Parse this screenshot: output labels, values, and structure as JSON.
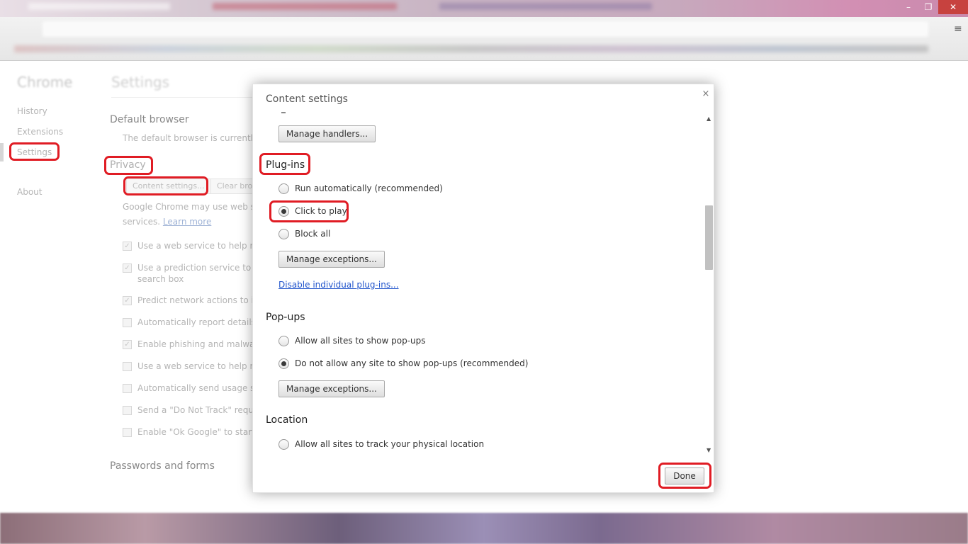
{
  "window": {
    "minimize_icon": "minimize-icon",
    "maximize_icon": "maximize-icon",
    "close_icon": "close-icon"
  },
  "sidebar": {
    "brand": "Chrome",
    "items": [
      {
        "label": "History"
      },
      {
        "label": "Extensions"
      },
      {
        "label": "Settings"
      },
      {
        "label": "About"
      }
    ],
    "selected": "Settings"
  },
  "settings": {
    "heading": "Settings",
    "default_browser": {
      "title": "Default browser",
      "text": "The default browser is currently Go"
    },
    "privacy": {
      "title": "Privacy",
      "content_settings_button": "Content settings...",
      "clear_button": "Clear brow",
      "description_line1": "Google Chrome may use web servi",
      "description_line2": "services.",
      "learn_more": "Learn more",
      "checkboxes": [
        {
          "label": "Use a web service to help resol",
          "checked": true
        },
        {
          "label": "Use a prediction service to help",
          "label2": "search box",
          "checked": true
        },
        {
          "label": "Predict network actions to imp",
          "checked": true
        },
        {
          "label": "Automatically report details of",
          "checked": false
        },
        {
          "label": "Enable phishing and malware p",
          "checked": true
        },
        {
          "label": "Use a web service to help resol",
          "checked": false
        },
        {
          "label": "Automatically send usage statis",
          "checked": false
        },
        {
          "label": "Send a \"Do Not Track\" request",
          "checked": false
        },
        {
          "label": "Enable \"Ok Google\" to start a v",
          "checked": false
        }
      ]
    },
    "passwords": {
      "title": "Passwords and forms"
    }
  },
  "dialog": {
    "title": "Content settings",
    "close_icon": "×",
    "manage_handlers_button": "Manage handlers...",
    "plugins": {
      "title": "Plug-ins",
      "options": [
        {
          "label": "Run automatically (recommended)",
          "checked": false
        },
        {
          "label": "Click to play",
          "checked": true
        },
        {
          "label": "Block all",
          "checked": false
        }
      ],
      "manage_exceptions_button": "Manage exceptions...",
      "disable_link": "Disable individual plug-ins..."
    },
    "popups": {
      "title": "Pop-ups",
      "options": [
        {
          "label": "Allow all sites to show pop-ups",
          "checked": false
        },
        {
          "label": "Do not allow any site to show pop-ups (recommended)",
          "checked": true
        }
      ],
      "manage_exceptions_button": "Manage exceptions..."
    },
    "location": {
      "title": "Location",
      "options": [
        {
          "label": "Allow all sites to track your physical location",
          "checked": false
        }
      ]
    },
    "done_button": "Done"
  },
  "highlight_color": "#e01c24"
}
